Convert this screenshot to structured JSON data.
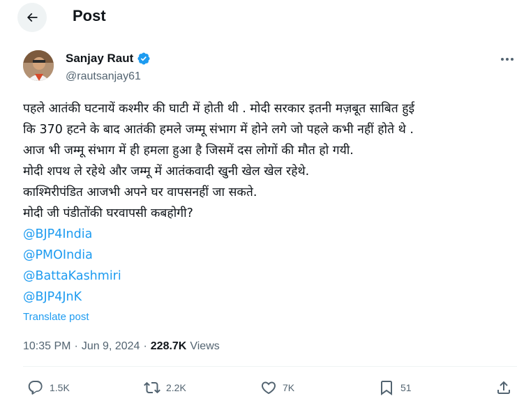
{
  "header": {
    "title": "Post",
    "back_icon": "arrow-left-icon"
  },
  "author": {
    "display_name": "Sanjay Raut",
    "handle": "@rautsanjay61",
    "verified_color": "#1d9bf0"
  },
  "post": {
    "lines": [
      "पहले आतंकी घटनायें कश्मीर की घाटी में होती थी . मोदी सरकार इतनी मज़बूत साबित हुई",
      "कि 370 हटने के बाद आतंकी हमले जम्मू संभाग में होने लगे जो पहले कभी नहीं होते थे .",
      "आज भी जम्मू संभाग में ही हमला हुआ है जिसमें दस लोगों की मौत हो गयी.",
      "मोदी शपथ ले रहेथे और जम्मू में आतंकवादी खुनी खेल खेल रहेथे.",
      "काश्मिरीपंडित आजभी अपने घर वापसनहीं जा सकते.",
      "मोदी जी पंडीतोंकी घरवापसी कबहोगी?"
    ],
    "mentions": [
      "@BJP4India",
      "@PMOIndia",
      "@BattaKashmiri",
      "@BJP4JnK"
    ],
    "translate_label": "Translate post",
    "time": "10:35 PM",
    "date": "Jun 9, 2024",
    "views_count": "228.7K",
    "views_label": "Views"
  },
  "actions": {
    "replies": "1.5K",
    "reposts": "2.2K",
    "likes": "7K",
    "bookmarks": "51"
  },
  "colors": {
    "link": "#1d9bf0",
    "muted": "#536471",
    "text": "#0f1419"
  }
}
